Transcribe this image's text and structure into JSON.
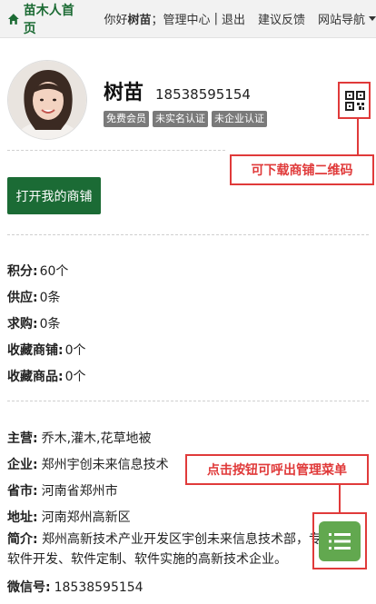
{
  "nav": {
    "home_label": "苗木人首页",
    "greeting": "你好",
    "username": "树苗",
    "greeting_sep": "；",
    "admin_center": "管理中心",
    "divider": "|",
    "logout": "退出",
    "feedback": "建议反馈",
    "site_nav": "网站导航"
  },
  "profile": {
    "name": "树苗",
    "phone": "18538595154",
    "badges": [
      "免费会员",
      "未实名认证",
      "未企业认证"
    ]
  },
  "callouts": {
    "qr": "可下载商铺二维码",
    "menu": "点击按钮可呼出管理菜单"
  },
  "shop_button": "打开我的商铺",
  "stats": [
    {
      "label": "积分:",
      "value": "60个"
    },
    {
      "label": "供应:",
      "value": "0条"
    },
    {
      "label": "求购:",
      "value": "0条"
    },
    {
      "label": "收藏商铺:",
      "value": "0个"
    },
    {
      "label": "收藏商品:",
      "value": "0个"
    }
  ],
  "info": {
    "main_label": "主营:",
    "main_value": "乔木,灌木,花草地被",
    "company_label": "企业:",
    "company_value": "郑州宇创未来信息技术",
    "province_label": "省市:",
    "province_value": "河南省郑州市",
    "address_label": "地址:",
    "address_value": "河南郑州高新区",
    "intro_label": "简介:",
    "intro_value": "郑州高新技术产业开发区宇创未来信息技术部，专业从事软件开发、软件定制、软件实施的高新技术企业。",
    "wechat_label": "微信号:",
    "wechat_value": "18538595154"
  },
  "colors": {
    "brand_green": "#1b6b35",
    "menu_green": "#62a84f",
    "callout_red": "#e03a3a",
    "badge_gray": "#7a7a7a"
  },
  "icons": {
    "home": "home-icon",
    "qr": "qr-code-icon",
    "menu": "list-menu-icon",
    "dropdown": "chevron-down-icon"
  }
}
